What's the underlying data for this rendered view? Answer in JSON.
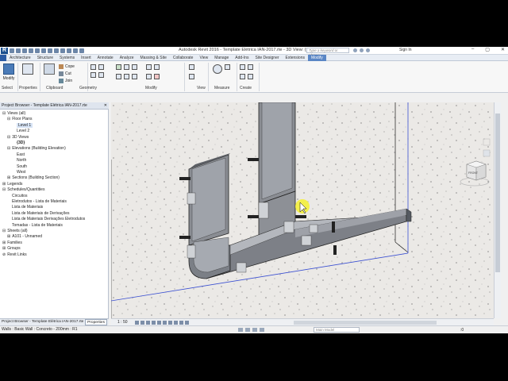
{
  "app": {
    "title": "Autodesk Revit 2016 -   Template Elétrica IAN-2017.rte - 3D View: {3D}",
    "logo": "R",
    "search_placeholder": "Type a keyword or phrase",
    "sign_in": "Sign In",
    "window_controls": [
      "–",
      "▢",
      "✕"
    ]
  },
  "ribbon": {
    "tabs": [
      "Architecture",
      "Structure",
      "Systems",
      "Insert",
      "Annotate",
      "Analyze",
      "Massing & Site",
      "Collaborate",
      "View",
      "Manage",
      "Add-Ins",
      "Site Designer",
      "Extensions",
      "Modify"
    ],
    "active_tab": "Modify",
    "modify_button": "Modify",
    "clipboard": {
      "paste": "Paste",
      "cut": "Cut",
      "join": "Join",
      "cope": "Cope"
    },
    "panels": [
      "Select",
      "Properties",
      "Clipboard",
      "Geometry",
      "Modify",
      "View",
      "Measure",
      "Create"
    ]
  },
  "project_browser": {
    "title": "Project Browser - Template Elétrica IAN-2017.rte",
    "close": "✕",
    "nodes": [
      {
        "label": "Views (all)",
        "indent": 0,
        "expander": "⊟"
      },
      {
        "label": "Floor Plans",
        "indent": 1,
        "expander": "⊟"
      },
      {
        "label": "Level 1",
        "indent": 3,
        "expander": "",
        "selected": true
      },
      {
        "label": "Level 2",
        "indent": 3,
        "expander": ""
      },
      {
        "label": "3D Views",
        "indent": 1,
        "expander": "⊟"
      },
      {
        "label": "{3D}",
        "indent": 3,
        "expander": "",
        "bold": true
      },
      {
        "label": "Elevations (Building Elevation)",
        "indent": 1,
        "expander": "⊟"
      },
      {
        "label": "East",
        "indent": 3,
        "expander": ""
      },
      {
        "label": "North",
        "indent": 3,
        "expander": ""
      },
      {
        "label": "South",
        "indent": 3,
        "expander": ""
      },
      {
        "label": "West",
        "indent": 3,
        "expander": ""
      },
      {
        "label": "Sections (Building Section)",
        "indent": 1,
        "expander": "⊞"
      },
      {
        "label": "Legends",
        "indent": 0,
        "expander": "⊞"
      },
      {
        "label": "Schedules/Quantities",
        "indent": 0,
        "expander": "⊟"
      },
      {
        "label": "Circuitos",
        "indent": 2,
        "expander": ""
      },
      {
        "label": "Eletrodutos - Lista de Materiais",
        "indent": 2,
        "expander": ""
      },
      {
        "label": "Lista de Materiais",
        "indent": 2,
        "expander": ""
      },
      {
        "label": "Lista de Materiais de Derivações",
        "indent": 2,
        "expander": ""
      },
      {
        "label": "Lista de Materiais Derivações Eletrodutos",
        "indent": 2,
        "expander": ""
      },
      {
        "label": "Tomadas - Lista de Materiais",
        "indent": 2,
        "expander": ""
      },
      {
        "label": "Sheets (all)",
        "indent": 0,
        "expander": "⊟"
      },
      {
        "label": "A101 - Unnamed",
        "indent": 1,
        "expander": "⊞"
      },
      {
        "label": "Families",
        "indent": 0,
        "expander": "⊞"
      },
      {
        "label": "Groups",
        "indent": 0,
        "expander": "⊞"
      },
      {
        "label": "Revit Links",
        "indent": 0,
        "expander": "⊘"
      }
    ],
    "footer": "Project Browser - Template Elétrica IAN-2017.rte",
    "properties_tab": "Properties"
  },
  "view": {
    "scale": "1 : 50",
    "viewcube_label": "FRONT"
  },
  "status": {
    "text": "Walls : Basic Wall : Concreto - 200mm : R1",
    "model": "Main Model",
    "right": ":0"
  }
}
